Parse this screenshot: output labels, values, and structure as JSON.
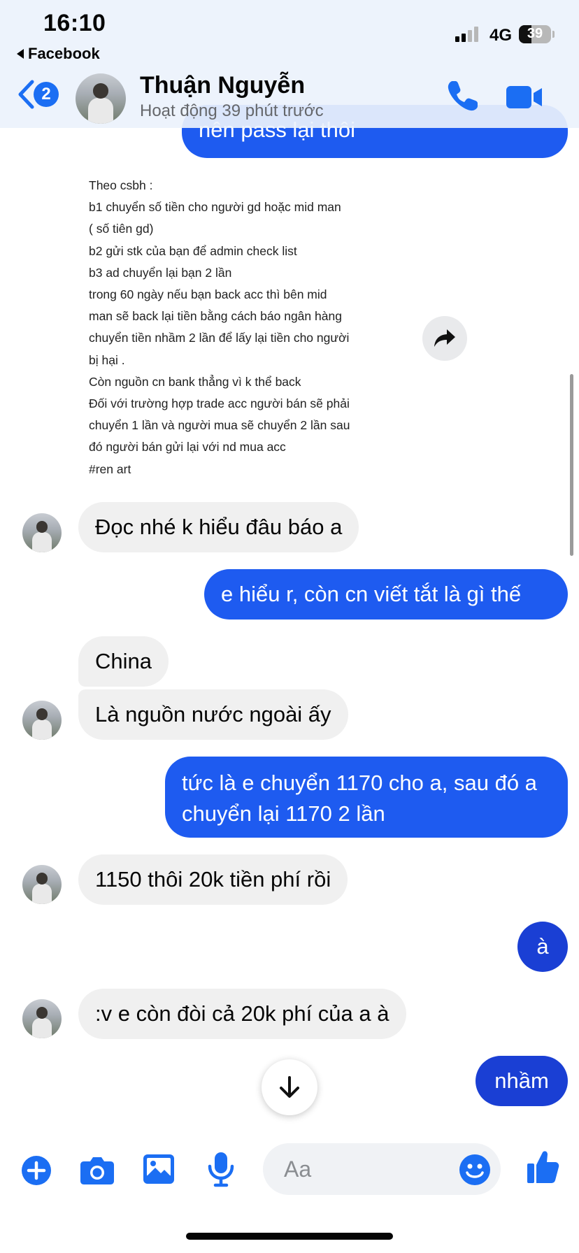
{
  "status_bar": {
    "time": "16:10",
    "back_app": "Facebook",
    "network": "4G",
    "battery": "39",
    "battery_level": 0.39
  },
  "header": {
    "back_badge": "2",
    "contact_name": "Thuận Nguyễn",
    "contact_status": "Hoạt động 39 phút trước"
  },
  "attachment_lines": [
    "Theo csbh :",
    "b1 chuyển số tiền cho người gd hoặc mid man",
    "( số tiên gd)",
    "b2 gửi stk của bạn để admin check list",
    "b3 ad chuyển lại bạn 2 lần",
    "trong 60 ngày nếu bạn back acc thì bên mid",
    "man sẽ back lại tiền bằng cách báo ngân hàng",
    "chuyển tiền nhầm 2 lần để lấy lại tiền cho người",
    "bị hại .",
    "Còn nguồn cn bank thẳng vì k thể back",
    "Đối với trường hợp trade acc người bán sẽ phải",
    "chuyển 1 lần và người mua sẽ chuyển 2 lần sau",
    "đó người bán gửi lại với nd mua acc",
    "#ren art"
  ],
  "messages": [
    {
      "id": "m0",
      "from": "me",
      "text": "nên pass lại thôi"
    },
    {
      "id": "m1",
      "from": "contact",
      "text": "Đọc nhé k hiểu đâu báo a"
    },
    {
      "id": "m2",
      "from": "me",
      "text": "e hiểu r, còn cn viết tắt là gì thế"
    },
    {
      "id": "m3",
      "from": "contact",
      "text": "China"
    },
    {
      "id": "m4",
      "from": "contact",
      "text": "Là nguồn nước ngoài ấy"
    },
    {
      "id": "m5",
      "from": "me",
      "text": "tức là e chuyển 1170 cho a, sau đó a chuyển lại 1170 2 lần"
    },
    {
      "id": "m6",
      "from": "contact",
      "text": "1150 thôi 20k tiền phí rồi"
    },
    {
      "id": "m7",
      "from": "me",
      "text": "à"
    },
    {
      "id": "m8",
      "from": "contact",
      "text": ":v e còn đòi cả 20k phí của a à"
    },
    {
      "id": "m9",
      "from": "me",
      "text": "nhầm"
    }
  ],
  "composer": {
    "placeholder": "Aa"
  },
  "icons": {
    "back": "chevron-left-icon",
    "call": "phone-icon",
    "video": "video-camera-icon",
    "forward": "share-arrow-icon",
    "scroll_down": "arrow-down-icon",
    "add": "plus-circle-icon",
    "camera": "camera-icon",
    "gallery": "image-icon",
    "mic": "microphone-icon",
    "emoji": "smiley-icon",
    "like": "thumbs-up-icon"
  },
  "colors": {
    "accent": "#1b6ef3",
    "outgoing_bubble": "#1e5bf0",
    "incoming_bubble": "#f0f0f0"
  }
}
